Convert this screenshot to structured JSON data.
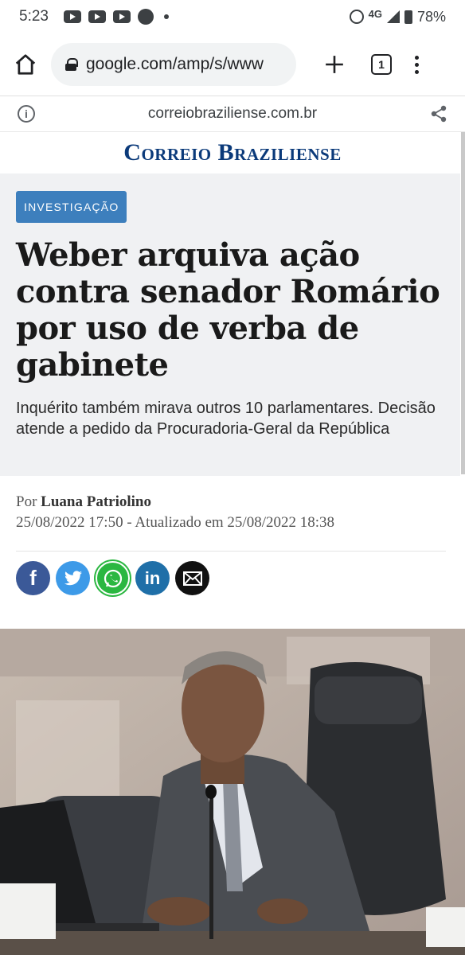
{
  "status_bar": {
    "time": "5:23",
    "network": "4G",
    "battery": "78%"
  },
  "browser": {
    "url": "google.com/amp/s/www",
    "tab_count": "1"
  },
  "amp_bar": {
    "domain": "correiobraziliense.com.br"
  },
  "site": {
    "logo": "Correio Braziliense"
  },
  "article": {
    "category": "INVESTIGAÇÃO",
    "headline": "Weber arquiva ação contra senador Romário por uso de verba de gabinete",
    "subtitle": "Inquérito também mirava outros 10 parlamentares. Decisão atende a pedido da Procuradoria-Geral da República",
    "by_prefix": "Por",
    "author": "Luana Patriolino",
    "dates": "25/08/2022 17:50 - Atualizado em 25/08/2022 18:38"
  },
  "share": {
    "facebook_glyph": "f",
    "twitter_glyph": "🐦",
    "whatsapp_glyph": "✆",
    "linkedin_glyph": "in",
    "email_glyph": "✉"
  },
  "colors": {
    "logo": "#0b3a7a",
    "category_tag": "#3d7fbd",
    "header_bg": "#f0f1f3"
  }
}
